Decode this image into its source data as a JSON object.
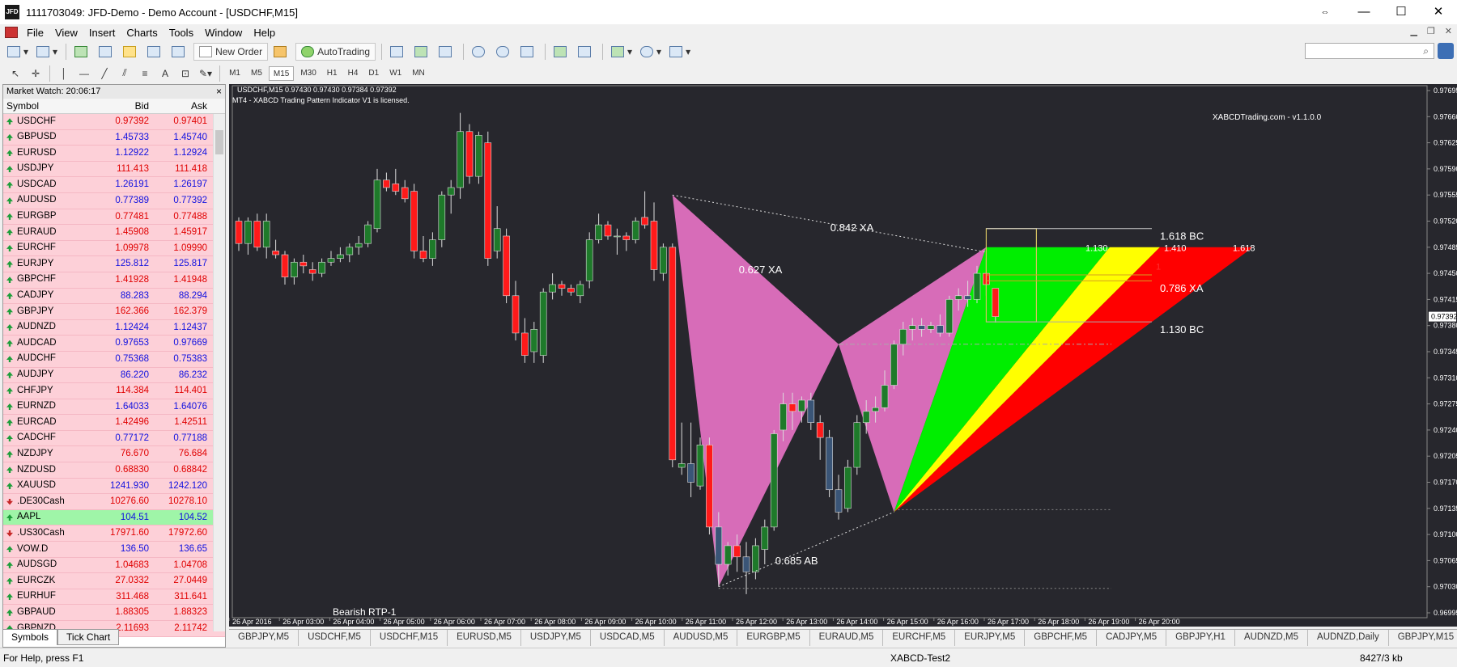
{
  "window": {
    "title": "1111703049: JFD-Demo - Demo Account - [USDCHF,M15]",
    "icon": "JFD",
    "minimize": "—",
    "maximize": "☐",
    "close": "✕",
    "restore": "⇔"
  },
  "menu": [
    "File",
    "View",
    "Insert",
    "Charts",
    "Tools",
    "Window",
    "Help"
  ],
  "toolbar": {
    "new_order": "New Order",
    "autotrading": "AutoTrading"
  },
  "timeframes": [
    "M1",
    "M5",
    "M15",
    "M30",
    "H1",
    "H4",
    "D1",
    "W1",
    "MN"
  ],
  "market_watch": {
    "title": "Market Watch: 20:06:17",
    "columns": [
      "Symbol",
      "Bid",
      "Ask"
    ],
    "tabs": [
      "Symbols",
      "Tick Chart"
    ],
    "rows": [
      {
        "symbol": "USDCHF",
        "bid": "0.97392",
        "ask": "0.97401",
        "dir": "up",
        "color": "red"
      },
      {
        "symbol": "GBPUSD",
        "bid": "1.45733",
        "ask": "1.45740",
        "dir": "up",
        "color": "blue"
      },
      {
        "symbol": "EURUSD",
        "bid": "1.12922",
        "ask": "1.12924",
        "dir": "up",
        "color": "blue"
      },
      {
        "symbol": "USDJPY",
        "bid": "111.413",
        "ask": "111.418",
        "dir": "up",
        "color": "red"
      },
      {
        "symbol": "USDCAD",
        "bid": "1.26191",
        "ask": "1.26197",
        "dir": "up",
        "color": "blue"
      },
      {
        "symbol": "AUDUSD",
        "bid": "0.77389",
        "ask": "0.77392",
        "dir": "up",
        "color": "blue"
      },
      {
        "symbol": "EURGBP",
        "bid": "0.77481",
        "ask": "0.77488",
        "dir": "up",
        "color": "red"
      },
      {
        "symbol": "EURAUD",
        "bid": "1.45908",
        "ask": "1.45917",
        "dir": "up",
        "color": "red"
      },
      {
        "symbol": "EURCHF",
        "bid": "1.09978",
        "ask": "1.09990",
        "dir": "up",
        "color": "red"
      },
      {
        "symbol": "EURJPY",
        "bid": "125.812",
        "ask": "125.817",
        "dir": "up",
        "color": "blue"
      },
      {
        "symbol": "GBPCHF",
        "bid": "1.41928",
        "ask": "1.41948",
        "dir": "up",
        "color": "red"
      },
      {
        "symbol": "CADJPY",
        "bid": "88.283",
        "ask": "88.294",
        "dir": "up",
        "color": "blue"
      },
      {
        "symbol": "GBPJPY",
        "bid": "162.366",
        "ask": "162.379",
        "dir": "up",
        "color": "red"
      },
      {
        "symbol": "AUDNZD",
        "bid": "1.12424",
        "ask": "1.12437",
        "dir": "up",
        "color": "blue"
      },
      {
        "symbol": "AUDCAD",
        "bid": "0.97653",
        "ask": "0.97669",
        "dir": "up",
        "color": "blue"
      },
      {
        "symbol": "AUDCHF",
        "bid": "0.75368",
        "ask": "0.75383",
        "dir": "up",
        "color": "blue"
      },
      {
        "symbol": "AUDJPY",
        "bid": "86.220",
        "ask": "86.232",
        "dir": "up",
        "color": "blue"
      },
      {
        "symbol": "CHFJPY",
        "bid": "114.384",
        "ask": "114.401",
        "dir": "up",
        "color": "red"
      },
      {
        "symbol": "EURNZD",
        "bid": "1.64033",
        "ask": "1.64076",
        "dir": "up",
        "color": "blue"
      },
      {
        "symbol": "EURCAD",
        "bid": "1.42496",
        "ask": "1.42511",
        "dir": "up",
        "color": "red"
      },
      {
        "symbol": "CADCHF",
        "bid": "0.77172",
        "ask": "0.77188",
        "dir": "up",
        "color": "blue"
      },
      {
        "symbol": "NZDJPY",
        "bid": "76.670",
        "ask": "76.684",
        "dir": "up",
        "color": "red"
      },
      {
        "symbol": "NZDUSD",
        "bid": "0.68830",
        "ask": "0.68842",
        "dir": "up",
        "color": "red"
      },
      {
        "symbol": "XAUUSD",
        "bid": "1241.930",
        "ask": "1242.120",
        "dir": "up",
        "color": "blue"
      },
      {
        "symbol": ".DE30Cash",
        "bid": "10276.60",
        "ask": "10278.10",
        "dir": "down",
        "color": "red"
      },
      {
        "symbol": "AAPL",
        "bid": "104.51",
        "ask": "104.52",
        "dir": "up",
        "color": "blue",
        "highlight": true
      },
      {
        "symbol": ".US30Cash",
        "bid": "17971.60",
        "ask": "17972.60",
        "dir": "down",
        "color": "red"
      },
      {
        "symbol": "VOW.D",
        "bid": "136.50",
        "ask": "136.65",
        "dir": "up",
        "color": "blue"
      },
      {
        "symbol": "AUDSGD",
        "bid": "1.04683",
        "ask": "1.04708",
        "dir": "up",
        "color": "red"
      },
      {
        "symbol": "EURCZK",
        "bid": "27.0332",
        "ask": "27.0449",
        "dir": "up",
        "color": "red"
      },
      {
        "symbol": "EURHUF",
        "bid": "311.468",
        "ask": "311.641",
        "dir": "up",
        "color": "red"
      },
      {
        "symbol": "GBPAUD",
        "bid": "1.88305",
        "ask": "1.88323",
        "dir": "up",
        "color": "red"
      },
      {
        "symbol": "GBPNZD",
        "bid": "2.11693",
        "ask": "2.11742",
        "dir": "up",
        "color": "red"
      }
    ]
  },
  "chart": {
    "symbol_header": "USDCHF,M15  0.97430 0.97430 0.97384 0.97392",
    "license_text": "MT4 - XABCD Trading Pattern Indicator V1 is licensed.",
    "brand": "XABCDTrading.com - v1.1.0.0",
    "pattern_name": "Bearish RTP-1",
    "current_price": "0.97392",
    "ratio_labels": {
      "xa_top": "0.842 XA",
      "xa_mid": "0.627 XA",
      "ab": "0.685 AB",
      "bc_top": "1.618 BC",
      "xa_786": "0.786 XA",
      "bc_bottom": "1.130 BC",
      "ext1": "1.130",
      "ext2": "1.410",
      "ext3": "1.618",
      "marker": "1"
    },
    "colors": {
      "bg": "#27272d",
      "bull": "#1e7a2a",
      "bear": "#ff1a1a",
      "neutral": "#3a5577",
      "pattern": "#e070c0",
      "green": "#00ee00",
      "yellow": "#ffff00",
      "red": "#ff0000"
    }
  },
  "chart_tabs": [
    "GBPJPY,M5",
    "USDCHF,M5",
    "USDCHF,M15",
    "EURUSD,M5",
    "USDJPY,M5",
    "USDCAD,M5",
    "AUDUSD,M5",
    "EURGBP,M5",
    "EURAUD,M5",
    "EURCHF,M5",
    "EURJPY,M5",
    "GBPCHF,M5",
    "CADJPY,M5",
    "GBPJPY,H1",
    "AUDNZD,M5",
    "AUDNZD,Daily",
    "GBPJPY,M15"
  ],
  "status": {
    "help": "For Help, press F1",
    "profile": "XABCD-Test2",
    "connection": "8427/3 kb"
  },
  "chart_data": {
    "type": "candlestick",
    "symbol": "USDCHF",
    "timeframe": "M15",
    "y_ticks": [
      "0.97695",
      "0.97660",
      "0.97625",
      "0.97590",
      "0.97555",
      "0.97520",
      "0.97485",
      "0.97450",
      "0.97415",
      "0.97380",
      "0.97345",
      "0.97310",
      "0.97275",
      "0.97240",
      "0.97205",
      "0.97170",
      "0.97135",
      "0.97100",
      "0.97065",
      "0.97030",
      "0.96995"
    ],
    "x_ticks": [
      "26 Apr 2016",
      "26 Apr 03:00",
      "26 Apr 04:00",
      "26 Apr 05:00",
      "26 Apr 06:00",
      "26 Apr 07:00",
      "26 Apr 08:00",
      "26 Apr 09:00",
      "26 Apr 10:00",
      "26 Apr 11:00",
      "26 Apr 12:00",
      "26 Apr 13:00",
      "26 Apr 14:00",
      "26 Apr 15:00",
      "26 Apr 16:00",
      "26 Apr 17:00",
      "26 Apr 18:00",
      "26 Apr 19:00",
      "26 Apr 20:00"
    ],
    "ylim": [
      0.96995,
      0.97695
    ],
    "candles": [
      [
        0.9752,
        0.97525,
        0.9748,
        0.9749
      ],
      [
        0.9749,
        0.97525,
        0.97475,
        0.9752
      ],
      [
        0.9752,
        0.9753,
        0.9748,
        0.97485
      ],
      [
        0.97485,
        0.9753,
        0.9747,
        0.9752
      ],
      [
        0.9748,
        0.97495,
        0.9747,
        0.97475
      ],
      [
        0.97475,
        0.9748,
        0.97435,
        0.97445
      ],
      [
        0.97445,
        0.9747,
        0.97435,
        0.97465
      ],
      [
        0.97465,
        0.97475,
        0.9745,
        0.9746
      ],
      [
        0.97455,
        0.97465,
        0.9744,
        0.9745
      ],
      [
        0.9745,
        0.9747,
        0.97445,
        0.97465
      ],
      [
        0.97465,
        0.9748,
        0.9746,
        0.9747
      ],
      [
        0.9747,
        0.97485,
        0.97465,
        0.97475
      ],
      [
        0.97475,
        0.9749,
        0.97465,
        0.97485
      ],
      [
        0.97485,
        0.975,
        0.97475,
        0.9749
      ],
      [
        0.9749,
        0.9752,
        0.97485,
        0.97515
      ],
      [
        0.9751,
        0.9759,
        0.97505,
        0.97575
      ],
      [
        0.97575,
        0.97585,
        0.9756,
        0.97565
      ],
      [
        0.9757,
        0.9759,
        0.97555,
        0.9756
      ],
      [
        0.97565,
        0.97575,
        0.97545,
        0.9755
      ],
      [
        0.9756,
        0.9757,
        0.9747,
        0.9748
      ],
      [
        0.9748,
        0.975,
        0.97465,
        0.9747
      ],
      [
        0.9747,
        0.97505,
        0.9746,
        0.97495
      ],
      [
        0.97495,
        0.9756,
        0.97485,
        0.97555
      ],
      [
        0.97555,
        0.97575,
        0.9753,
        0.97565
      ],
      [
        0.97565,
        0.97665,
        0.9755,
        0.9764
      ],
      [
        0.9764,
        0.9765,
        0.9757,
        0.9758
      ],
      [
        0.9758,
        0.9764,
        0.9757,
        0.97635
      ],
      [
        0.97625,
        0.9764,
        0.9746,
        0.9747
      ],
      [
        0.9748,
        0.9754,
        0.9747,
        0.9751
      ],
      [
        0.975,
        0.9751,
        0.9741,
        0.9742
      ],
      [
        0.9742,
        0.9744,
        0.9736,
        0.9737
      ],
      [
        0.9737,
        0.9739,
        0.9733,
        0.9734
      ],
      [
        0.97345,
        0.97385,
        0.9733,
        0.97375
      ],
      [
        0.9734,
        0.9743,
        0.9733,
        0.97425
      ],
      [
        0.97425,
        0.9745,
        0.97415,
        0.97435
      ],
      [
        0.97435,
        0.9744,
        0.9742,
        0.9743
      ],
      [
        0.9743,
        0.97435,
        0.9742,
        0.97425
      ],
      [
        0.9742,
        0.9744,
        0.9741,
        0.97435
      ],
      [
        0.9744,
        0.97505,
        0.9743,
        0.97495
      ],
      [
        0.97495,
        0.9753,
        0.9749,
        0.97515
      ],
      [
        0.97515,
        0.9752,
        0.97495,
        0.975
      ],
      [
        0.975,
        0.9751,
        0.97475,
        0.975
      ],
      [
        0.975,
        0.97505,
        0.9748,
        0.97495
      ],
      [
        0.97495,
        0.97525,
        0.9749,
        0.9752
      ],
      [
        0.97525,
        0.9756,
        0.9751,
        0.97515
      ],
      [
        0.9752,
        0.97545,
        0.9744,
        0.97455
      ],
      [
        0.9745,
        0.9749,
        0.9744,
        0.97485
      ],
      [
        0.97485,
        0.9749,
        0.9719,
        0.972
      ],
      [
        0.9719,
        0.9725,
        0.9718,
        0.97195
      ],
      [
        0.97195,
        0.9725,
        0.9715,
        0.9717
      ],
      [
        0.97165,
        0.9723,
        0.9716,
        0.9722
      ],
      [
        0.9722,
        0.9723,
        0.971,
        0.9711
      ],
      [
        0.9711,
        0.9713,
        0.9703,
        0.9706
      ],
      [
        0.9706,
        0.9709,
        0.97045,
        0.97085
      ],
      [
        0.97085,
        0.971,
        0.9705,
        0.9707
      ],
      [
        0.9707,
        0.9709,
        0.9702,
        0.9705
      ],
      [
        0.9705,
        0.97095,
        0.9704,
        0.97085
      ],
      [
        0.9708,
        0.9712,
        0.9706,
        0.9711
      ],
      [
        0.9711,
        0.9724,
        0.97105,
        0.97235
      ],
      [
        0.9724,
        0.9729,
        0.97225,
        0.97275
      ],
      [
        0.97275,
        0.9729,
        0.9724,
        0.97265
      ],
      [
        0.97265,
        0.97285,
        0.9725,
        0.9728
      ],
      [
        0.9728,
        0.9729,
        0.9724,
        0.9725
      ],
      [
        0.9725,
        0.9726,
        0.972,
        0.9723
      ],
      [
        0.9723,
        0.9724,
        0.9715,
        0.9716
      ],
      [
        0.9716,
        0.9718,
        0.9712,
        0.9713
      ],
      [
        0.97135,
        0.972,
        0.9713,
        0.9719
      ],
      [
        0.9719,
        0.9726,
        0.9718,
        0.9725
      ],
      [
        0.9725,
        0.9728,
        0.97235,
        0.97265
      ],
      [
        0.97265,
        0.97285,
        0.9725,
        0.9727
      ],
      [
        0.9727,
        0.9732,
        0.97265,
        0.973
      ],
      [
        0.973,
        0.9736,
        0.97295,
        0.97355
      ],
      [
        0.97355,
        0.97385,
        0.9734,
        0.97375
      ],
      [
        0.97375,
        0.9739,
        0.9736,
        0.9738
      ],
      [
        0.9738,
        0.9739,
        0.97365,
        0.97375
      ],
      [
        0.97375,
        0.97385,
        0.9737,
        0.9738
      ],
      [
        0.9738,
        0.97395,
        0.97365,
        0.9737
      ],
      [
        0.9737,
        0.9742,
        0.97365,
        0.97415
      ],
      [
        0.97415,
        0.9743,
        0.974,
        0.9742
      ],
      [
        0.9742,
        0.9744,
        0.97405,
        0.97415
      ],
      [
        0.97415,
        0.9746,
        0.9741,
        0.9745
      ],
      [
        0.9745,
        0.9747,
        0.9742,
        0.97435
      ],
      [
        0.9743,
        0.9743,
        0.97384,
        0.97392
      ]
    ],
    "pattern": {
      "X": [
        47,
        0.97555
      ],
      "A": [
        52,
        0.9703
      ],
      "B": [
        65,
        0.97355
      ],
      "C": [
        71,
        0.9713
      ],
      "D": [
        81,
        0.97485
      ]
    },
    "labels": [
      "0.842 XA",
      "0.627 XA",
      "0.685 AB",
      "1.618 BC",
      "0.786 XA",
      "1.130 BC",
      "1.130",
      "1.410",
      "1.618",
      "Bearish RTP-1",
      "XABCDTrading.com - v1.1.0.0"
    ]
  }
}
